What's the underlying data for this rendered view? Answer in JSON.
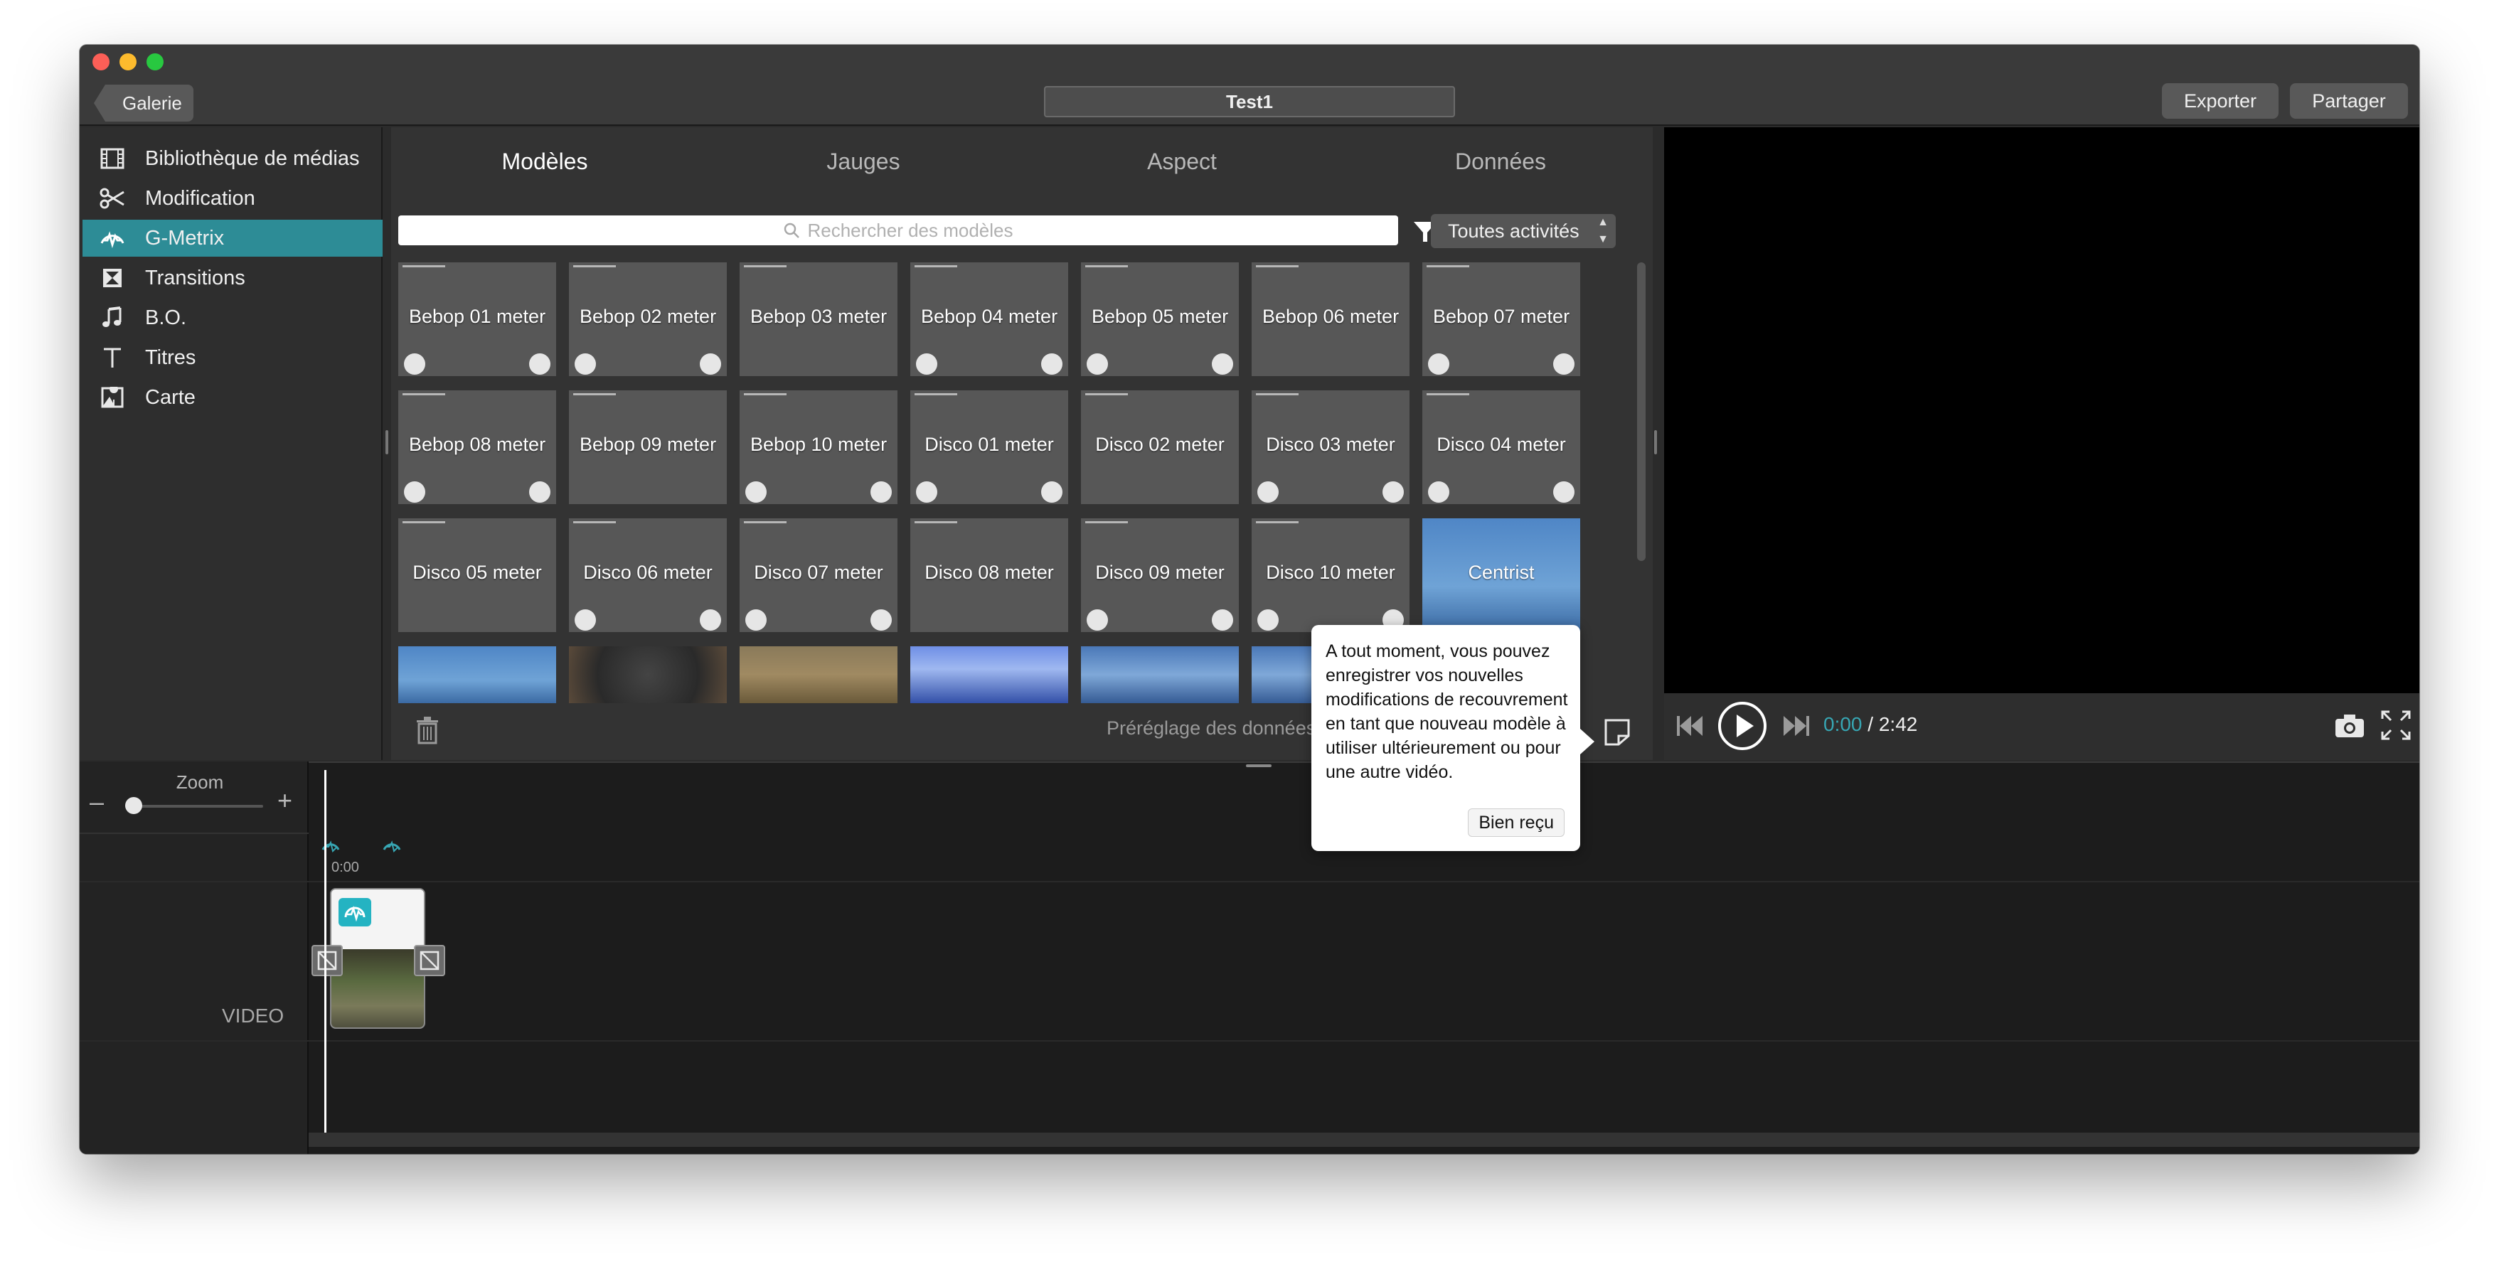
{
  "window": {
    "back_label": "Galerie",
    "title": "Test1",
    "export_label": "Exporter",
    "share_label": "Partager"
  },
  "sidebar": {
    "items": [
      {
        "label": "Bibliothèque de médias",
        "icon": "film-icon"
      },
      {
        "label": "Modification",
        "icon": "scissors-icon"
      },
      {
        "label": "G-Metrix",
        "icon": "gmetrix-icon",
        "active": true
      },
      {
        "label": "Transitions",
        "icon": "hourglass-icon"
      },
      {
        "label": "B.O.",
        "icon": "music-note-icon"
      },
      {
        "label": "Titres",
        "icon": "text-t-icon"
      },
      {
        "label": "Carte",
        "icon": "map-icon"
      }
    ]
  },
  "tabs": [
    {
      "label": "Modèles",
      "active": true
    },
    {
      "label": "Jauges"
    },
    {
      "label": "Aspect"
    },
    {
      "label": "Données"
    }
  ],
  "search": {
    "placeholder": "Rechercher des modèles"
  },
  "filter": {
    "selected": "Toutes activités"
  },
  "templates": [
    "Bebop 01 meter",
    "Bebop 02 meter",
    "Bebop 03 meter",
    "Bebop 04 meter",
    "Bebop 05 meter",
    "Bebop 06 meter",
    "Bebop 07 meter",
    "Bebop 08 meter",
    "Bebop 09 meter",
    "Bebop 10 meter",
    "Disco 01 meter",
    "Disco 02 meter",
    "Disco 03 meter",
    "Disco 04 meter",
    "Disco 05 meter",
    "Disco 06 meter",
    "Disco 07 meter",
    "Disco 08 meter",
    "Disco 09 meter",
    "Disco 10 meter",
    "Centrist"
  ],
  "footer": {
    "preset_label": "Préréglage des données"
  },
  "player": {
    "current_time": "0:00",
    "separator": " / ",
    "duration": "2:42"
  },
  "timeline": {
    "zoom_label": "Zoom",
    "zoom_minus": "–",
    "zoom_plus": "+",
    "ruler_time": "0:00",
    "video_track_label": "VIDEO"
  },
  "tooltip": {
    "text": "A tout moment, vous pouvez enregistrer vos nouvelles modifications de recouvrement en tant que nouveau modèle à utiliser ultérieurement ou pour une autre vidéo.",
    "button_label": "Bien reçu"
  },
  "colors": {
    "accent": "#2d8c96",
    "time_accent": "#37a6b3",
    "window_bg": "#2b2b2b"
  }
}
